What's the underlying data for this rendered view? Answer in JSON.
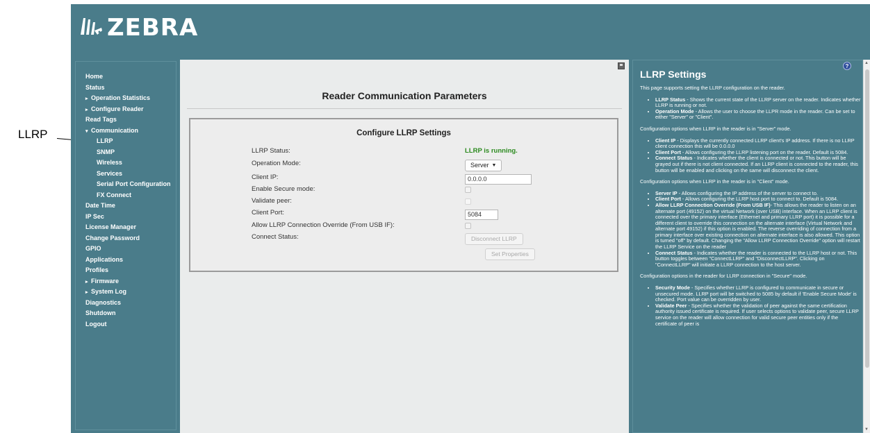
{
  "callout": {
    "label": "LLRP"
  },
  "header": {
    "brand": "ZEBRA"
  },
  "sidebar": {
    "items": [
      {
        "label": "Home",
        "level": 0,
        "caret": ""
      },
      {
        "label": "Status",
        "level": 0,
        "caret": ""
      },
      {
        "label": "Operation Statistics",
        "level": 0,
        "caret": "▸"
      },
      {
        "label": "Configure Reader",
        "level": 0,
        "caret": "▸"
      },
      {
        "label": "Read Tags",
        "level": 0,
        "caret": ""
      },
      {
        "label": "Communication",
        "level": 0,
        "caret": "▾"
      },
      {
        "label": "LLRP",
        "level": 1,
        "caret": ""
      },
      {
        "label": "SNMP",
        "level": 1,
        "caret": ""
      },
      {
        "label": "Wireless",
        "level": 1,
        "caret": ""
      },
      {
        "label": "Services",
        "level": 1,
        "caret": ""
      },
      {
        "label": "Serial Port Configuration",
        "level": 1,
        "caret": ""
      },
      {
        "label": "FX Connect",
        "level": 1,
        "caret": ""
      },
      {
        "label": "Date Time",
        "level": 0,
        "caret": ""
      },
      {
        "label": "IP Sec",
        "level": 0,
        "caret": ""
      },
      {
        "label": "License Manager",
        "level": 0,
        "caret": ""
      },
      {
        "label": "Change Password",
        "level": 0,
        "caret": ""
      },
      {
        "label": "GPIO",
        "level": 0,
        "caret": ""
      },
      {
        "label": "Applications",
        "level": 0,
        "caret": ""
      },
      {
        "label": "Profiles",
        "level": 0,
        "caret": ""
      },
      {
        "label": "Firmware",
        "level": 0,
        "caret": "▸"
      },
      {
        "label": "System Log",
        "level": 0,
        "caret": "▸"
      },
      {
        "label": "Diagnostics",
        "level": 0,
        "caret": ""
      },
      {
        "label": "Shutdown",
        "level": 0,
        "caret": ""
      },
      {
        "label": "Logout",
        "level": 0,
        "caret": ""
      }
    ]
  },
  "main": {
    "title": "Reader Communication Parameters",
    "config": {
      "title": "Configure LLRP Settings",
      "llrp_status_label": "LLRP Status:",
      "llrp_status_value": "LLRP is running.",
      "operation_mode_label": "Operation Mode:",
      "operation_mode_value": "Server",
      "client_ip_label": "Client IP:",
      "client_ip_value": "0.0.0.0",
      "secure_mode_label": "Enable Secure mode:",
      "validate_peer_label": "Validate peer:",
      "client_port_label": "Client Port:",
      "client_port_value": "5084",
      "override_label": "Allow LLRP Connection Override (From USB IF):",
      "connect_status_label": "Connect Status:",
      "disconnect_button": "Disconnect LLRP",
      "set_properties_button": "Set Properties"
    }
  },
  "help": {
    "title": "LLRP Settings",
    "question_mark": "?",
    "intro": "This page supports setting the LLRP configuration on the reader.",
    "items1": [
      {
        "term": "LLRP Status",
        "text": " - Shows the current state of the LLRP server on the reader. Indicates whether LLRP is running or not."
      },
      {
        "term": "Operation Mode",
        "text": " - Allows the user to choose the LLPR mode in the reader. Can be set to either \"Server\" or \"Client\"."
      }
    ],
    "server_intro": "Configuration options when LLRP in the reader is in \"Server\" mode.",
    "items2": [
      {
        "term": "Client IP",
        "text": " - Displays the currently connected LLRP client's IP address. If there is no LLRP client connection this will be 0.0.0.0"
      },
      {
        "term": "Client Port",
        "text": " - Allows configuring the LLRP listening port on the reader. Default is 5084."
      },
      {
        "term": "Connect Status",
        "text": " - Indicates whether the client is connected or not. This button will be grayed out if there is not client connected. If an LLRP client is connected to the reader, this button will be enabled and clicking on the same will disconnect the client."
      }
    ],
    "client_intro": "Configuration options when LLRP in the reader is in \"Client\" mode.",
    "items3": [
      {
        "term": "Server IP",
        "text": " - Allows configuring the IP address of the server to connect to."
      },
      {
        "term": "Client Port",
        "text": " - Allows configuring the LLRP host port to connect to. Default is 5084."
      },
      {
        "term": "Allow LLRP Connection Override (From USB IF)",
        "text": "- This allows the reader to listen on an alternate port (49152) on the virtual Network (over USB) interface. When an LLRP client is connected over the primary interface (Ethernet and primary LLRP port) it is possible for a different client to override this connection on the alternate interface (Virtual Network and alternate port 49152) if this option is enabled. The reverse overriding of connection from a primary interface over existing connection on alternate interface is also allowed. This option is turned \"off\" by default. Changing the \"Allow LLRP Connection Override\" option will restart the LLRP Service on the reader"
      },
      {
        "term": "Connect Status",
        "text": " - Indicates whether the reader is connected to the LLRP host or not. This button toggles between \"ConnectLLRP\" and \"DisconnectLLRP\". Clicking on \"ConnectLLRP\" will initiate a LLRP connection to the host server."
      }
    ],
    "secure_intro": "Configuration options in the reader for LLRP connection in \"Secure\" mode.",
    "items4": [
      {
        "term": "Security Mode",
        "text": " - Specifies whether LLRP is configured to communicate in secure or unsecured mode. LLRP port will be switched to 5085 by default if 'Enable Secure Mode' is checked. Port value can be overridden by user."
      },
      {
        "term": "Validate Peer",
        "text": " - Specifies whether the validation of peer against the same certification authority issued certificate is required. If user selects options to validate peer, secure LLRP service on the reader will allow connection for valid secure peer entities only if the certificate of peer is"
      }
    ]
  }
}
